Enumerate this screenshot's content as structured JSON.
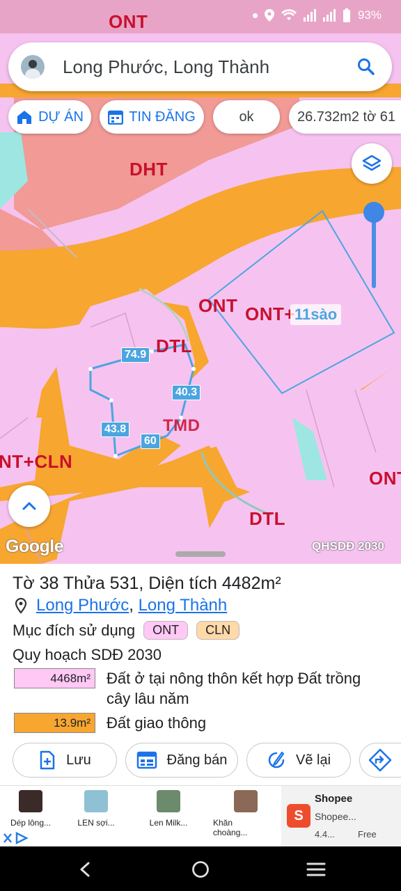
{
  "status": {
    "battery": "93%"
  },
  "search": {
    "query": "Long Phước, Long Thành"
  },
  "chips": [
    {
      "label": "DỰ ÁN",
      "icon": "home-icon"
    },
    {
      "label": "TIN ĐĂNG",
      "icon": "calendar-icon"
    },
    {
      "label": "ok"
    },
    {
      "label": "26.732m2 tờ 61"
    }
  ],
  "map": {
    "zones": [
      "ONT",
      "DHT",
      "ONT",
      "ONT+",
      "DTL",
      "NT+CLN",
      "ONT",
      "DTL",
      "TMD"
    ],
    "edges": [
      "74.9",
      "40.3",
      "43.8",
      "60"
    ],
    "area_badge": "11sào",
    "attribution": "Google",
    "layer_tag": "QHSDĐ 2030",
    "colors": {
      "residential": "#f6c3f0",
      "road": "#f7a630",
      "water": "#9ee6e1",
      "public": "#f19a96",
      "boundary": "#4ba5e0"
    }
  },
  "parcel": {
    "title": "Tờ 38 Thửa 531, Diện tích 4482m²",
    "ward": "Long Phước",
    "separator": ",",
    "district": "Long Thành",
    "purpose_label": "Mục đích sử dụng",
    "purposes": [
      "ONT",
      "CLN"
    ],
    "plan_title": "Quy hoạch SDĐ 2030",
    "plan_items": [
      {
        "area": "4468m²",
        "desc": "Đất ở tại nông thôn kết hợp Đất trồng cây lâu năm",
        "color": "#ffc8f5"
      },
      {
        "area": "13.9m²",
        "desc": "Đất giao thông",
        "color": "#f7a630"
      }
    ]
  },
  "actions": [
    {
      "label": "Lưu",
      "icon": "add-file-icon"
    },
    {
      "label": "Đăng bán",
      "icon": "listing-icon"
    },
    {
      "label": "Vẽ lại",
      "icon": "redraw-icon"
    },
    {
      "label": "",
      "icon": "directions-icon"
    }
  ],
  "ad": {
    "items": [
      "Dép lông...",
      "LEN sợi...",
      "Len Milk...",
      "Khăn choàng..."
    ],
    "brand": "Shopee",
    "sub": "Shopee...",
    "rating": "4.4...",
    "price": "Free"
  }
}
